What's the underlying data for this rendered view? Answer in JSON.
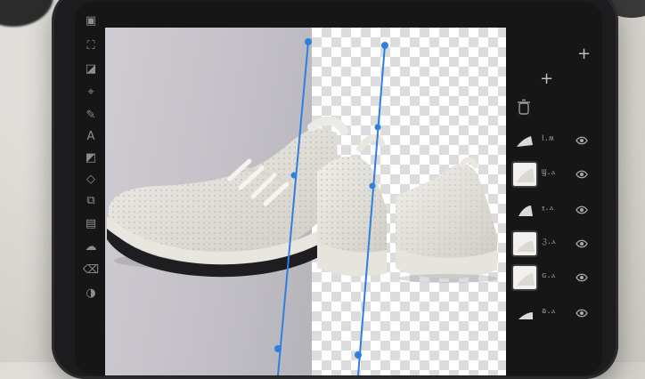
{
  "toolbar": {
    "tools": [
      {
        "icon": "layers-icon",
        "glyph": "▣"
      },
      {
        "icon": "crop-icon",
        "glyph": "⛶"
      },
      {
        "icon": "transform-icon",
        "glyph": "◪"
      },
      {
        "icon": "selection-icon",
        "glyph": "⌖"
      },
      {
        "icon": "brush-icon",
        "glyph": "✎"
      },
      {
        "icon": "text-icon",
        "glyph": "A"
      },
      {
        "icon": "mask-icon",
        "glyph": "◩"
      },
      {
        "icon": "shape-icon",
        "glyph": "◇"
      },
      {
        "icon": "clone-icon",
        "glyph": "⧉"
      },
      {
        "icon": "fill-icon",
        "glyph": "▤"
      },
      {
        "icon": "smudge-icon",
        "glyph": "☁"
      },
      {
        "icon": "eraser-icon",
        "glyph": "⌫"
      },
      {
        "icon": "adjust-icon",
        "glyph": "◑"
      }
    ]
  },
  "panel": {
    "add_icon": "plus-icon",
    "delete_icon": "trash-icon",
    "layers": [
      {
        "label": "Ⅰ.ʍ",
        "icon": "eye-icon"
      },
      {
        "label": "Ϣ.ⲁ",
        "icon": "eye-icon"
      },
      {
        "label": "ⲝ.ⲁ",
        "icon": "eye-icon"
      },
      {
        "label": "ℨ.ⲁ",
        "icon": "eye-icon"
      },
      {
        "label": "ɢ.ⲁ",
        "icon": "eye-icon"
      },
      {
        "label": "ɷ.ⲁ",
        "icon": "eye-icon"
      }
    ]
  },
  "canvas": {
    "accent_color": "#2f7fe0"
  }
}
